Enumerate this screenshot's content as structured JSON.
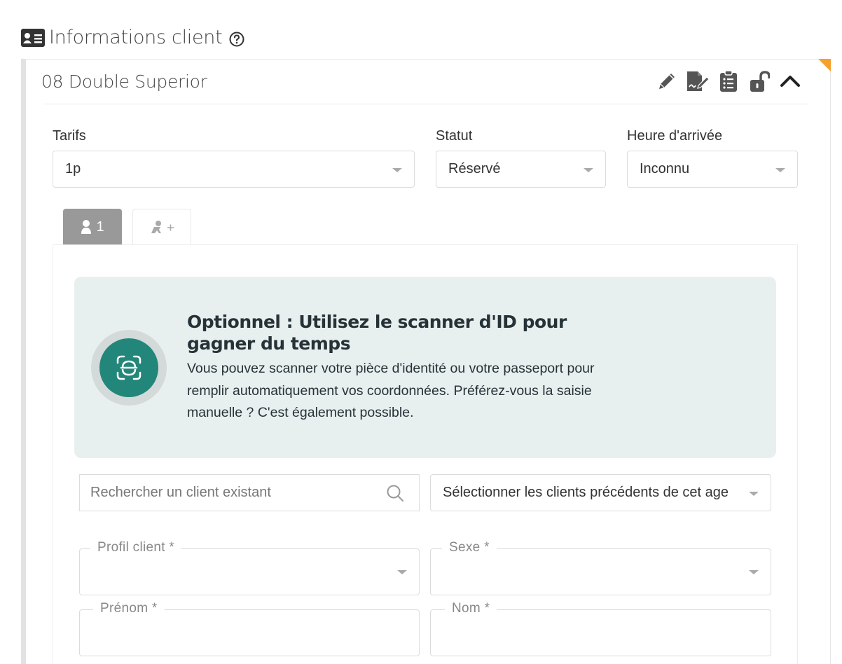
{
  "header": {
    "title": "Informations client"
  },
  "room": {
    "title": "08 Double Superior"
  },
  "fields": {
    "tarifs": {
      "label": "Tarifs",
      "value": "1p"
    },
    "statut": {
      "label": "Statut",
      "value": "Réservé"
    },
    "arrival": {
      "label": "Heure d'arrivée",
      "value": "Inconnu"
    }
  },
  "tabs": {
    "guest_label": "1"
  },
  "scanner": {
    "title": "Optionnel : Utilisez le scanner d'ID pour gagner du temps",
    "description": "Vous pouvez scanner votre pièce d'identité ou votre passeport pour remplir automatiquement vos coordonnées. Préférez-vous la saisie manuelle ? C'est également possible."
  },
  "search": {
    "placeholder": "Rechercher un client existant"
  },
  "previous_clients": {
    "value": "Sélectionner les clients précédents de cet age"
  },
  "form": {
    "profile_label": "Profil client *",
    "sexe_label": "Sexe *",
    "prenom_label": "Prénom *",
    "nom_label": "Nom *"
  },
  "colors": {
    "accent": "#23867a",
    "corner_flag": "#f5a12b",
    "banner_bg": "#e8f0ef"
  }
}
